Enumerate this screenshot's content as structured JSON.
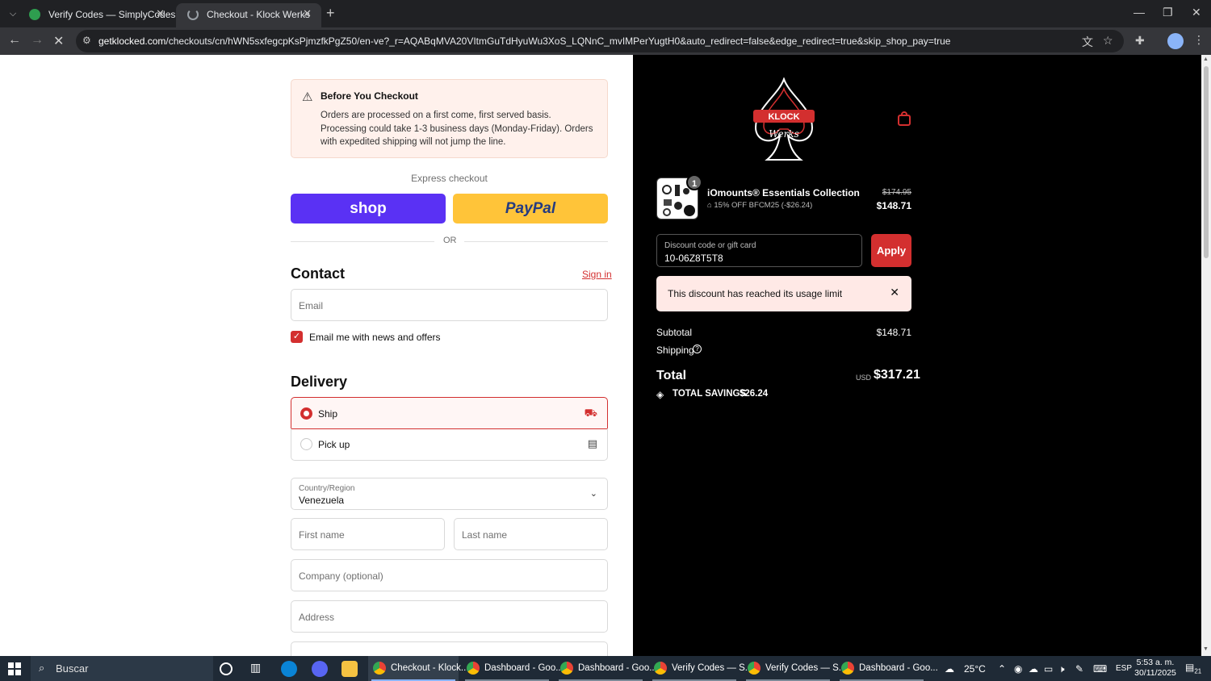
{
  "browser": {
    "tabs": [
      {
        "label": "Verify Codes — SimplyCodes",
        "active": false
      },
      {
        "label": "Checkout - Klock Werks",
        "active": true
      }
    ],
    "url_domain": "getklocked.com",
    "url_rest": "/checkouts/cn/hWN5sxfegcpKsPjmzfkPgZ50/en-ve?_r=AQABqMVA20VItmGuTdHyuWu3XoS_LQNnC_mvIMPerYugtH0&auto_redirect=false&edge_redirect=true&skip_shop_pay=true"
  },
  "notice": {
    "title": "Before You Checkout",
    "text": "Orders are processed on a first come, first served basis. Processing could take 1-3 business days (Monday-Friday). Orders with expedited shipping will not jump the line."
  },
  "express": {
    "label": "Express checkout",
    "shop_label": "shop",
    "paypal_label": "PayPal",
    "or_label": "OR"
  },
  "contact": {
    "title": "Contact",
    "signin": "Sign in",
    "email_placeholder": "Email",
    "newsletter_label": "Email me with news and offers",
    "newsletter_checked": true
  },
  "delivery": {
    "title": "Delivery",
    "options": [
      {
        "label": "Ship",
        "selected": true
      },
      {
        "label": "Pick up",
        "selected": false
      }
    ],
    "country_label": "Country/Region",
    "country_value": "Venezuela",
    "first_name": "First name",
    "last_name": "Last name",
    "company": "Company (optional)",
    "address": "Address"
  },
  "summary": {
    "product": {
      "name": "iOmounts® Essentials Collection",
      "discount": "15% OFF BFCM25 (-$26.24)",
      "old_price": "$174.95",
      "price": "$148.71",
      "quantity": "1"
    },
    "discount_label": "Discount code or gift card",
    "discount_value": "10-06Z8T5T8",
    "apply_label": "Apply",
    "alert": "This discount has reached its usage limit",
    "subtotal_label": "Subtotal",
    "subtotal_value": "$148.71",
    "shipping_label": "Shipping",
    "total_label": "Total",
    "currency": "USD",
    "total_value": "$317.21",
    "savings_label": "TOTAL SAVINGS",
    "savings_value": "$26.24"
  },
  "taskbar": {
    "search": "Buscar",
    "apps": [
      "Checkout - Klock...",
      "Dashboard - Goo...",
      "Dashboard - Goo...",
      "Verify Codes — S...",
      "Verify Codes — S...",
      "Dashboard - Goo..."
    ],
    "weather": "25°C",
    "language": "ESP",
    "time": "5:53 a. m.",
    "date": "30/11/2025",
    "notifications": "21"
  },
  "colors": {
    "accent": "#d32f2f",
    "shop": "#5a31f4",
    "paypal": "#ffc439"
  }
}
